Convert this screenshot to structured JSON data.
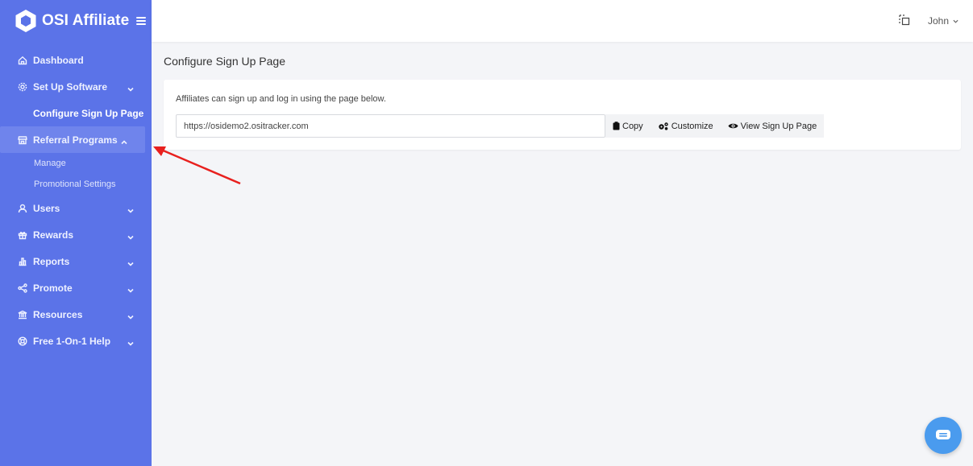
{
  "brand": {
    "name": "OSI Affiliate"
  },
  "sidebar": {
    "items": [
      {
        "label": "Dashboard",
        "icon": "home-icon"
      },
      {
        "label": "Set Up Software",
        "icon": "gear-icon"
      },
      {
        "label": "Configure Sign Up Page"
      },
      {
        "label": "Referral Programs",
        "icon": "store-icon"
      },
      {
        "label": "Manage"
      },
      {
        "label": "Promotional Settings"
      },
      {
        "label": "Users",
        "icon": "user-icon"
      },
      {
        "label": "Rewards",
        "icon": "gift-icon"
      },
      {
        "label": "Reports",
        "icon": "bar-chart-icon"
      },
      {
        "label": "Promote",
        "icon": "share-icon"
      },
      {
        "label": "Resources",
        "icon": "bank-icon"
      },
      {
        "label": "Free 1-On-1 Help",
        "icon": "lifebuoy-icon"
      }
    ]
  },
  "topbar": {
    "user_name": "John"
  },
  "main": {
    "title": "Configure Sign Up Page",
    "description": "Affiliates can sign up and log in using the page below.",
    "url_value": "https://osidemo2.ositracker.com",
    "buttons": {
      "copy": "Copy",
      "customize": "Customize",
      "view": "View Sign Up Page"
    }
  },
  "colors": {
    "sidebar": "#5b73e8",
    "active_item": "#6f84ec",
    "chat": "#4a9bee",
    "arrow": "#e8201e"
  }
}
